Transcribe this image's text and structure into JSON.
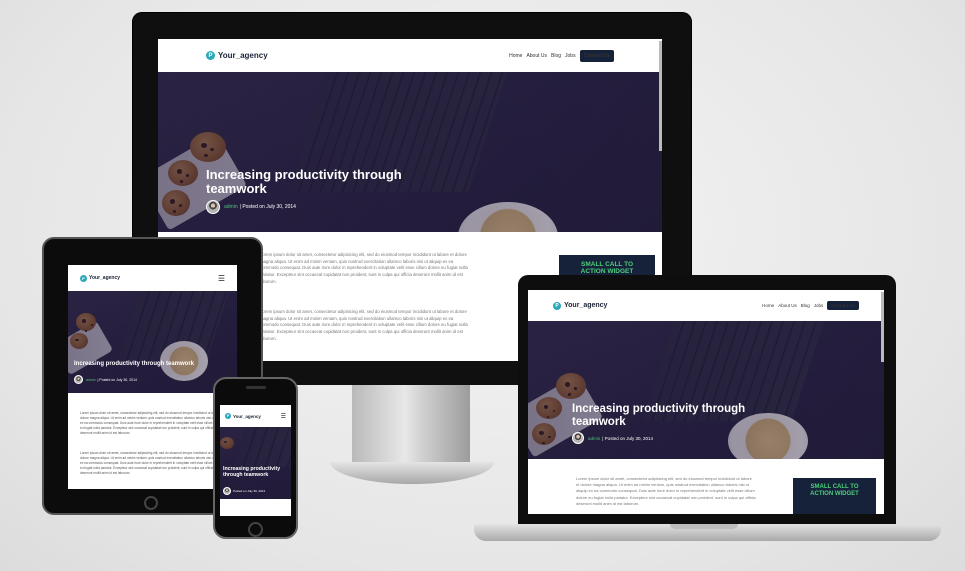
{
  "site": {
    "logo_mark": "P",
    "logo_text": "Your_agency",
    "menu": [
      "Home",
      "About Us",
      "Blog",
      "Jobs"
    ],
    "cta_label": "Contact Us"
  },
  "post": {
    "title": "Increasing productivity through teamwork",
    "author": "admin",
    "posted_on": "| Posted on July 30, 2014",
    "posted_on_short": "Posted on July 30, 2014"
  },
  "content": {
    "paragraph": "Lorem ipsum dolor sit amet, consectetur adipisicing elit, sed do eiusmod tempor incididunt ut labore et dolore magna aliqua. Ut enim ad minim veniam, quis nostrud exercitation ullamco laboris nisi ut aliquip ex ea commodo consequat. Duis aute irure dolor in reprehenderit in voluptate velit esse cillum dolore eu fugiat nulla pariatur. Excepteur sint occaecat cupidatat non proident, sunt in culpa qui officia deserunt mollit anim id est laborum."
  },
  "widget": {
    "label": "SMALL CALL TO ACTION WIDGET"
  },
  "icons": {
    "hamburger": "menu-icon"
  },
  "colors": {
    "navy": "#16213a",
    "accent_green": "#4cd07a",
    "logo_teal": "#2aa8b8"
  }
}
